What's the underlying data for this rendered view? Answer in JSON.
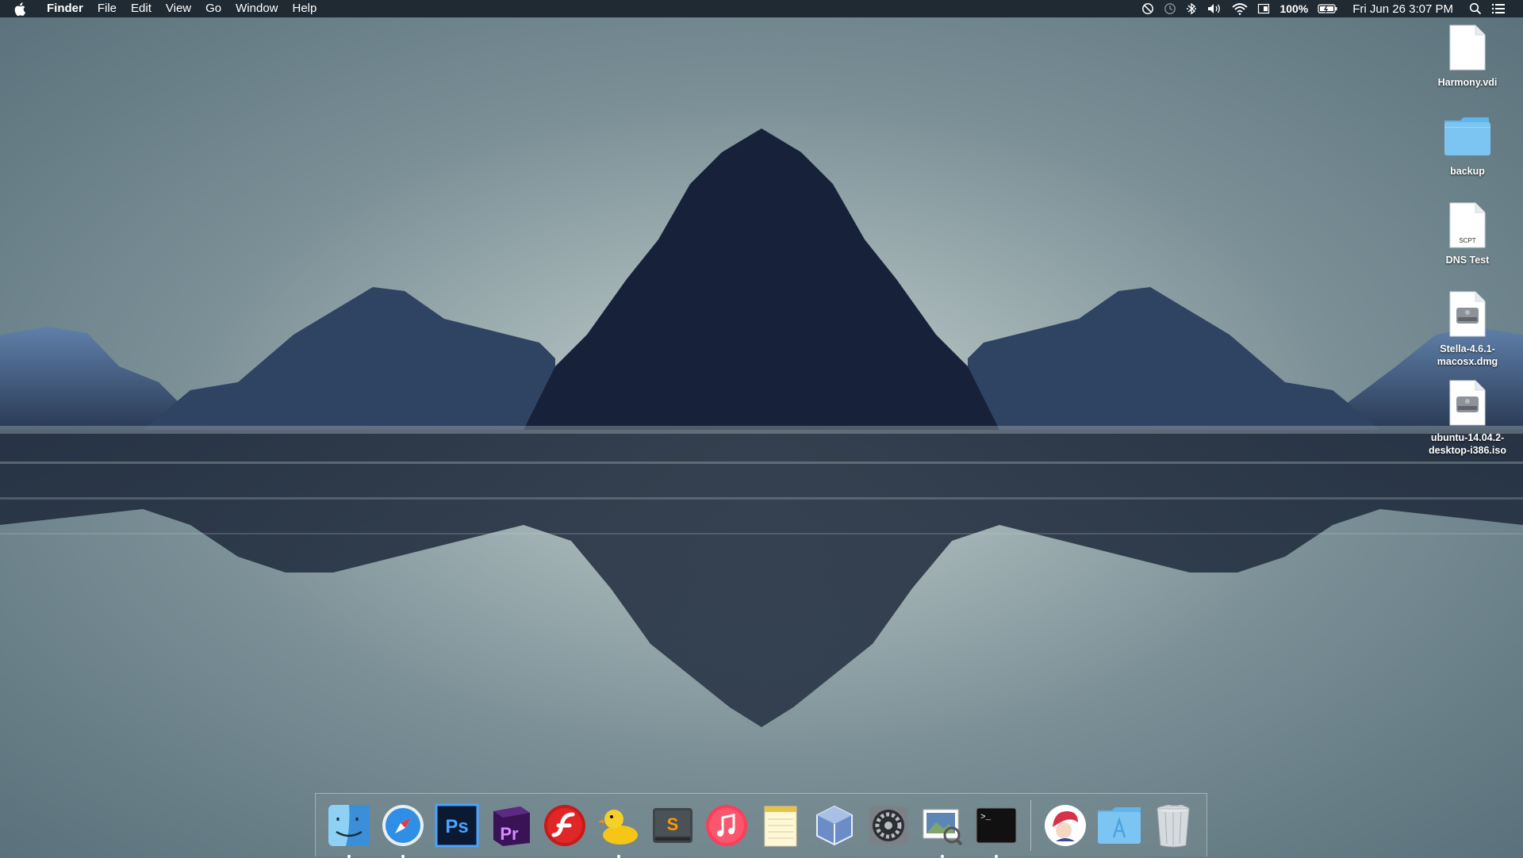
{
  "menubar": {
    "apple_icon": "apple-icon",
    "app_name": "Finder",
    "menus": [
      "File",
      "Edit",
      "View",
      "Go",
      "Window",
      "Help"
    ],
    "status": {
      "battery_percent": "100%",
      "clock": "Fri Jun 26  3:07 PM"
    }
  },
  "desktop": {
    "items": [
      {
        "name": "Harmony.vdi",
        "type": "document"
      },
      {
        "name": "backup",
        "type": "folder"
      },
      {
        "name": "DNS Test",
        "type": "script",
        "badge": "SCPT"
      },
      {
        "name": "Stella-4.6.1-macosx.dmg",
        "type": "disk-image"
      },
      {
        "name": "ubuntu-14.04.2-desktop-i386.iso",
        "type": "disk-image"
      }
    ]
  },
  "dock": {
    "apps": [
      {
        "name": "Finder",
        "icon": "finder-icon",
        "running": true
      },
      {
        "name": "Safari",
        "icon": "safari-icon",
        "running": true
      },
      {
        "name": "Photoshop",
        "icon": "photoshop-icon",
        "label": "Ps",
        "running": false
      },
      {
        "name": "Premiere Pro",
        "icon": "premiere-icon",
        "label": "Pr",
        "running": false
      },
      {
        "name": "Flash",
        "icon": "flash-icon",
        "running": false
      },
      {
        "name": "Cyberduck",
        "icon": "duck-icon",
        "running": true
      },
      {
        "name": "Sublime Text",
        "icon": "sublime-icon",
        "label": "S",
        "running": false
      },
      {
        "name": "iTunes",
        "icon": "itunes-icon",
        "running": false
      },
      {
        "name": "Notes",
        "icon": "notes-icon",
        "running": false
      },
      {
        "name": "VirtualBox",
        "icon": "virtualbox-icon",
        "running": false
      },
      {
        "name": "System Preferences",
        "icon": "gear-icon",
        "running": false
      },
      {
        "name": "Preview",
        "icon": "preview-icon",
        "running": true
      },
      {
        "name": "Terminal",
        "icon": "terminal-icon",
        "label": ">_",
        "running": true
      }
    ],
    "others": [
      {
        "name": "Avatar",
        "icon": "avatar-icon"
      },
      {
        "name": "Applications",
        "icon": "applications-folder-icon"
      },
      {
        "name": "Trash",
        "icon": "trash-icon"
      }
    ]
  }
}
